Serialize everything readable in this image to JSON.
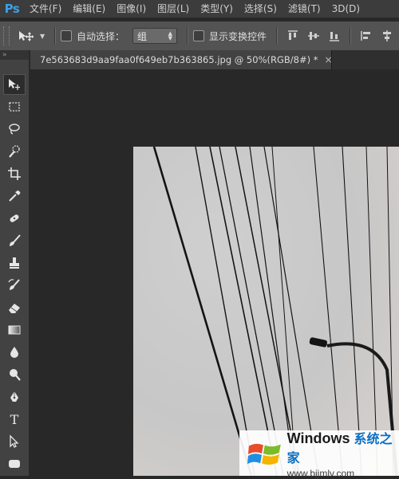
{
  "app": {
    "logo": "Ps"
  },
  "menu": [
    "文件(F)",
    "编辑(E)",
    "图像(I)",
    "图层(L)",
    "类型(Y)",
    "选择(S)",
    "滤镜(T)",
    "3D(D)"
  ],
  "options": {
    "auto_select_label": "自动选择：",
    "auto_select_checked": false,
    "auto_select_value": "组",
    "show_transform_label": "显示变换控件",
    "show_transform_checked": false
  },
  "toolbox_grip": "»",
  "document": {
    "tab_title": "7e563683d9aa9faa0f649eb7b363865.jpg @ 50%(RGB/8#) *",
    "close_glyph": "×"
  },
  "tools": [
    {
      "icon": "move-tool-icon",
      "active": true
    },
    {
      "icon": "marquee-tool-icon"
    },
    {
      "icon": "lasso-tool-icon"
    },
    {
      "icon": "quick-selection-tool-icon"
    },
    {
      "icon": "crop-tool-icon"
    },
    {
      "icon": "eyedropper-tool-icon"
    },
    {
      "icon": "spot-healing-tool-icon"
    },
    {
      "icon": "brush-tool-icon"
    },
    {
      "icon": "clone-stamp-tool-icon"
    },
    {
      "icon": "history-brush-tool-icon"
    },
    {
      "icon": "eraser-tool-icon"
    },
    {
      "icon": "gradient-tool-icon"
    },
    {
      "icon": "blur-tool-icon"
    },
    {
      "icon": "dodge-tool-icon"
    },
    {
      "icon": "pen-tool-icon"
    },
    {
      "icon": "type-tool-icon",
      "letter": "T"
    },
    {
      "icon": "path-selection-tool-icon"
    },
    {
      "icon": "rectangle-tool-icon"
    }
  ],
  "watermark": {
    "title": "Windows",
    "title_cn": "系统之家",
    "url": "www.bjjmlv.com"
  },
  "colors": {
    "menubar": "#3c3c3c",
    "optionsbar": "#535353",
    "toolbox": "#424242",
    "workspace": "#282828",
    "ps_blue": "#3ba0e8"
  }
}
